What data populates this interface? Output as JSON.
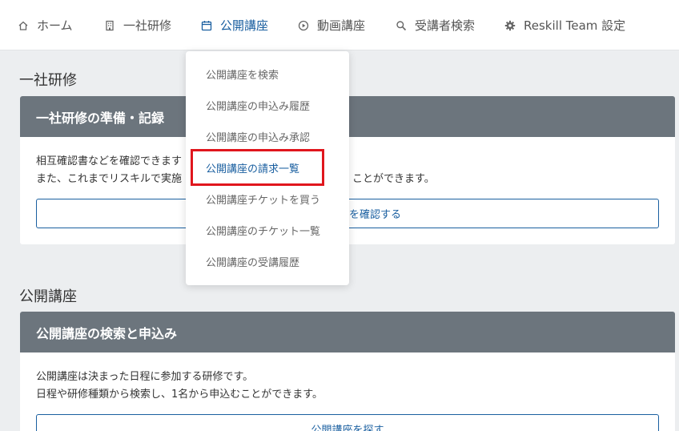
{
  "nav": {
    "items": [
      {
        "label": "ホーム",
        "icon": "home-icon"
      },
      {
        "label": "一社研修",
        "icon": "building-icon"
      },
      {
        "label": "公開講座",
        "icon": "calendar-icon",
        "active": true
      },
      {
        "label": "動画講座",
        "icon": "play-circle-icon"
      },
      {
        "label": "受講者検索",
        "icon": "search-icon"
      },
      {
        "label": "Reskill Team 設定",
        "icon": "gear-icon"
      }
    ]
  },
  "dropdown": {
    "items": [
      "公開講座を検索",
      "公開講座の申込み履歴",
      "公開講座の申込み承認",
      "公開講座の請求一覧",
      "公開講座チケットを買う",
      "公開講座のチケット一覧",
      "公開講座の受講履歴"
    ],
    "highlighted_index": 3
  },
  "section1": {
    "title": "一社研修",
    "card_header": "一社研修の準備・記録",
    "line1": "相互確認書などを確認できます",
    "line2": "また、これまでリスキルで実施",
    "line2_tail": "ことができます。",
    "button_tail": "を確認する"
  },
  "section2": {
    "title": "公開講座",
    "card_header": "公開講座の検索と申込み",
    "line1": "公開講座は決まった日程に参加する研修です。",
    "line2": "日程や研修種類から検索し、1名から申込むことができます。",
    "button_label": "公開講座を探す"
  },
  "colors": {
    "accent": "#1a5fa0",
    "card_header_bg": "#6c757d",
    "page_bg": "#eceef0",
    "highlight_border": "#e0161d"
  }
}
